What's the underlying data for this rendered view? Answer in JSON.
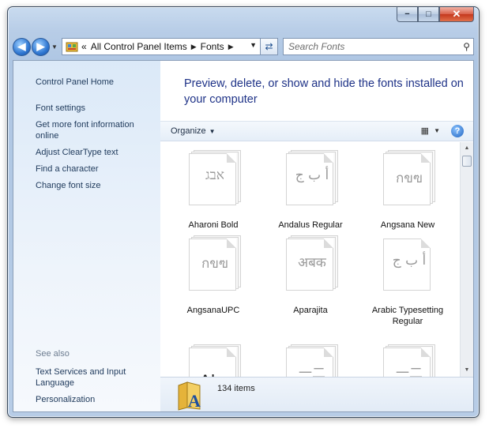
{
  "window": {
    "controls": {
      "minimize": "−",
      "maximize": "□",
      "close": "✕"
    }
  },
  "nav": {
    "back_icon": "back-arrow-icon",
    "forward_icon": "forward-arrow-icon",
    "overflow": "«",
    "breadcrumb": [
      "All Control Panel Items",
      "Fonts"
    ],
    "search_placeholder": "Search Fonts"
  },
  "left_pane": {
    "links": [
      "Control Panel Home",
      "Font settings",
      "Get more font information online",
      "Adjust ClearType text",
      "Find a character",
      "Change font size"
    ],
    "see_also_label": "See also",
    "see_also_links": [
      "Text Services and Input Language",
      "Personalization"
    ]
  },
  "main": {
    "heading": "Preview, delete, or show and hide the fonts installed on your computer",
    "organize_label": "Organize",
    "fonts": [
      {
        "name": "Aharoni Bold",
        "glyph": "אבג",
        "stack": true
      },
      {
        "name": "Andalus Regular",
        "glyph": "أ ب ج",
        "stack": true
      },
      {
        "name": "Angsana New",
        "glyph": "กขฃ",
        "stack": true
      },
      {
        "name": "AngsanaUPC",
        "glyph": "กขฃ",
        "stack": true
      },
      {
        "name": "Aparajita",
        "glyph": "अबक",
        "stack": true
      },
      {
        "name": "Arabic Typesetting Regular",
        "glyph": "أ ب ج",
        "stack": false
      },
      {
        "name": "",
        "glyph": "Abg",
        "stack": true
      },
      {
        "name": "",
        "glyph": "一二",
        "stack": true
      },
      {
        "name": "",
        "glyph": "一二",
        "stack": true
      }
    ],
    "status_count": "134 items"
  },
  "colors": {
    "heading": "#1e3287",
    "link": "#1e395b",
    "accent": "#2f77d2"
  }
}
